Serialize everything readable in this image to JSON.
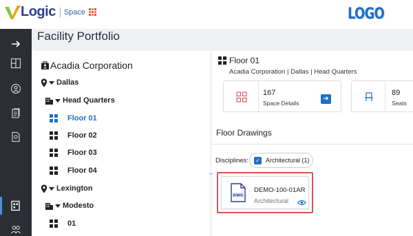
{
  "header": {
    "brand_name": "Logic",
    "brand_module": "Space",
    "logo_text": "LOGO"
  },
  "page": {
    "title": "Facility Portfolio"
  },
  "rail": {
    "items": [
      "expand-arrow-icon",
      "layout-icon",
      "user-location-icon",
      "documents-icon",
      "map-document-icon",
      "floor-plan-icon",
      "people-icon"
    ]
  },
  "tree": {
    "organization": "Acadia Corporation",
    "sites": [
      {
        "name": "Dallas",
        "buildings": [
          {
            "name": "Head Quarters",
            "floors": [
              "Floor 01",
              "Floor 02",
              "Floor 03",
              "Floor 04"
            ]
          }
        ]
      },
      {
        "name": "Lexington",
        "buildings": [
          {
            "name": "Modesto",
            "floors": [
              "01"
            ]
          }
        ]
      }
    ],
    "selected": "Floor 01"
  },
  "detail": {
    "title": "Floor 01",
    "subtitle": "Acadia Corporation | Dallas | Head Quarters",
    "stats": [
      {
        "value": "167",
        "label": "Space Details"
      },
      {
        "value": "89",
        "label": "Seats"
      }
    ],
    "drawings_title": "Floor Drawings",
    "disciplines_label": "Disciplines:",
    "discipline_chip": "Architectural (1)",
    "drawing": {
      "name": "DEMO-100-01AR",
      "type": "Architectural",
      "file_badge": "DWG"
    }
  },
  "colors": {
    "brand_blue": "#2c3e8c",
    "accent_blue": "#1f6fc4",
    "rail_bg": "#2b2f33",
    "highlight_red": "#d9534f"
  }
}
